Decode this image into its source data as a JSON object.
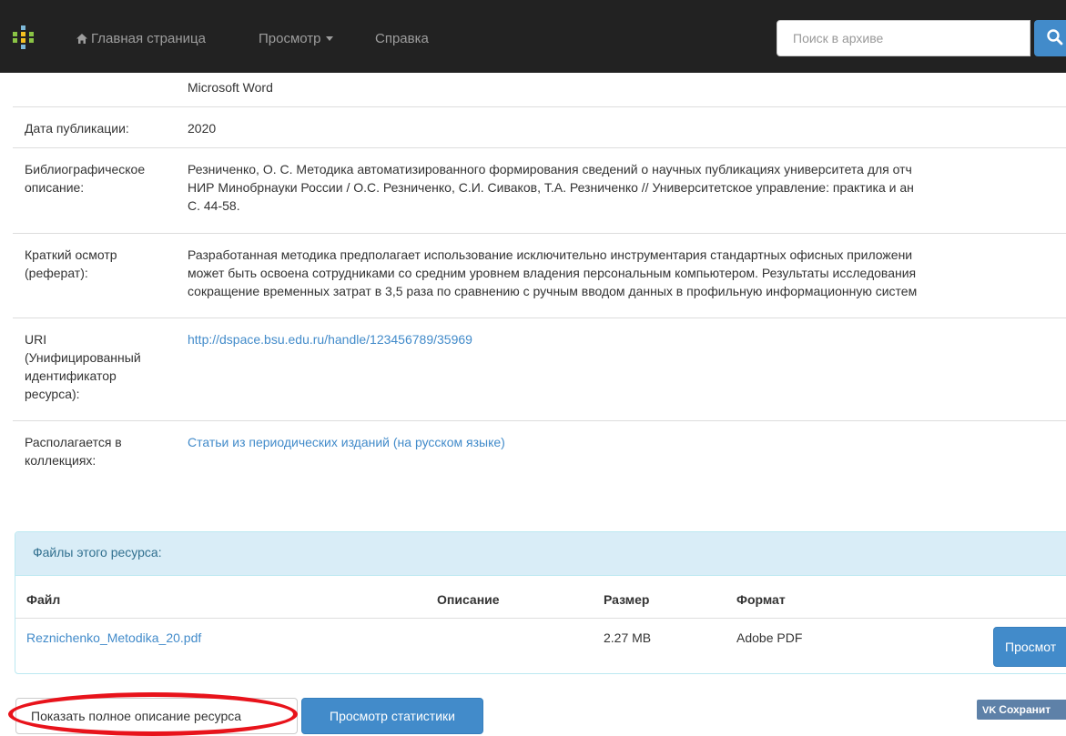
{
  "navbar": {
    "home_label": "Главная страница",
    "browse_label": "Просмотр",
    "help_label": "Справка",
    "search_placeholder": "Поиск в архиве",
    "colors": {
      "background": "#222222",
      "link": "#9d9d9d",
      "accent": "#428bca"
    }
  },
  "metadata": {
    "format_value": "Microsoft Word",
    "date_label": "Дата публикации:",
    "date_value": "2020",
    "citation_label_1": "Библиографическое",
    "citation_label_2": "описание:",
    "citation_line_1": "Резниченко, О. С. Методика автоматизированного формирования сведений о научных публикациях университета для отч",
    "citation_line_2": "НИР Минобрнауки России / О.С. Резниченко, С.И. Сиваков, Т.А. Резниченко // Университетское управление: практика и ан",
    "citation_line_3": "С. 44-58.",
    "abstract_label_1": "Краткий осмотр",
    "abstract_label_2": "(реферат):",
    "abstract_line_1": "Разработанная методика предполагает использование исключительно инструментария стандартных офисных приложени",
    "abstract_line_2": "может быть освоена сотрудниками со средним уровнем владения персональным компьютером. Результаты исследования",
    "abstract_line_3": "сокращение временных затрат в 3,5 раза по сравнению с ручным вводом данных в профильную информационную систем",
    "uri_label_1": "URI",
    "uri_label_2": "(Унифицированный",
    "uri_label_3": "идентификатор",
    "uri_label_4": "ресурса):",
    "uri_value": "http://dspace.bsu.edu.ru/handle/123456789/35969",
    "collection_label_1": "Располагается в",
    "collection_label_2": "коллекциях:",
    "collection_value": "Статьи из периодических изданий (на русском языке)"
  },
  "files": {
    "panel_title": "Файлы этого ресурса:",
    "headers": {
      "file": "Файл",
      "description": "Описание",
      "size": "Размер",
      "format": "Формат"
    },
    "rows": [
      {
        "file": "Reznichenko_Metodika_20.pdf",
        "description": "",
        "size": "2.27 MB",
        "format": "Adobe PDF",
        "view_label": "Просмот"
      }
    ]
  },
  "actions": {
    "show_full_label": "Показать полное описание ресурса",
    "stats_label": "Просмотр статистики",
    "vk_logo": "VK",
    "vk_label": "Сохранит"
  }
}
